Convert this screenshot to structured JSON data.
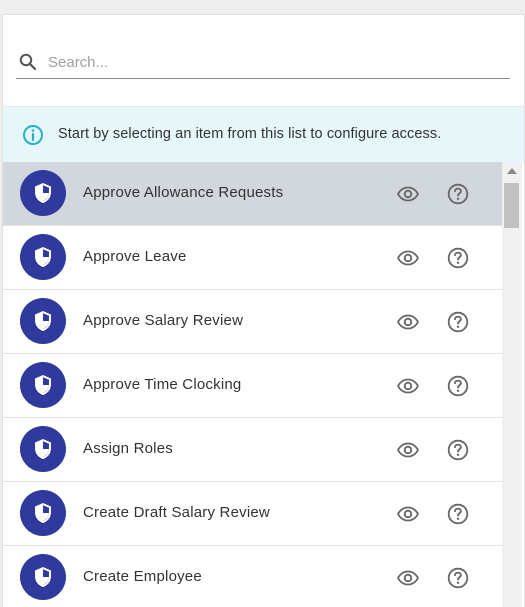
{
  "search": {
    "placeholder": "Search..."
  },
  "info_banner": {
    "text": "Start by selecting an item from this list to configure access."
  },
  "colors": {
    "avatar": "#2f3a9c",
    "selected_row": "#d1d7dd",
    "banner_bg": "#e6f6f9",
    "info_icon": "#1fb5c9"
  },
  "list": {
    "items": [
      {
        "label": "Approve Allowance Requests",
        "selected": true,
        "icon": "shield-icon"
      },
      {
        "label": "Approve Leave",
        "selected": false,
        "icon": "shield-icon"
      },
      {
        "label": "Approve Salary Review",
        "selected": false,
        "icon": "shield-icon"
      },
      {
        "label": "Approve Time Clocking",
        "selected": false,
        "icon": "shield-icon"
      },
      {
        "label": "Assign Roles",
        "selected": false,
        "icon": "shield-icon"
      },
      {
        "label": "Create Draft Salary Review",
        "selected": false,
        "icon": "shield-icon"
      },
      {
        "label": "Create Employee",
        "selected": false,
        "icon": "shield-icon"
      }
    ],
    "action_icons": [
      "eye-icon",
      "help-circle-icon"
    ]
  }
}
